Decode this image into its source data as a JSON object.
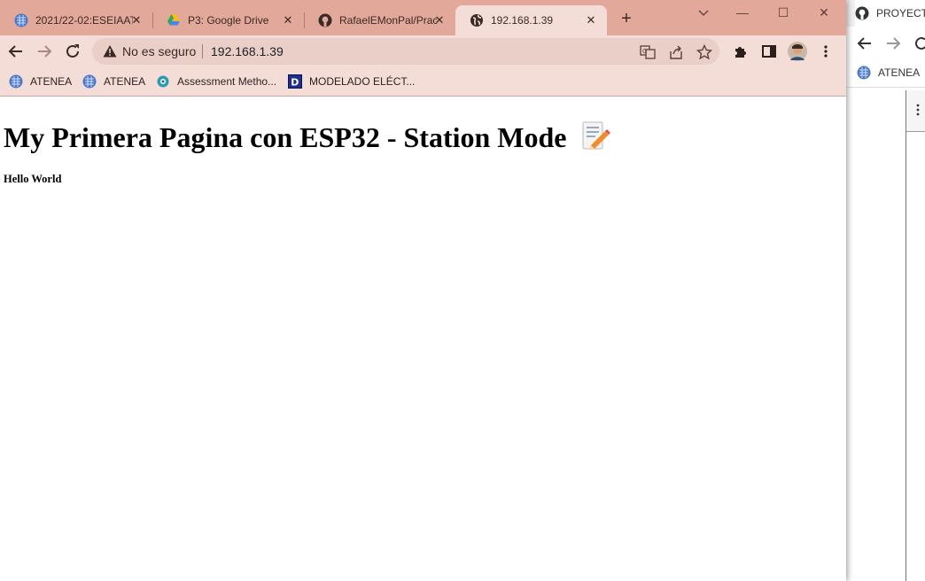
{
  "window": {
    "tabs": [
      {
        "title": "2021/22-02:ESEIAAT",
        "icon": "atenea-globe-icon"
      },
      {
        "title": "P3: Google Drive",
        "icon": "google-drive-icon"
      },
      {
        "title": "RafaelEMonPal/Prac",
        "icon": "github-icon"
      },
      {
        "title": "192.168.1.39",
        "icon": "globe-icon",
        "active": true
      }
    ],
    "controls": {
      "minimize": "—",
      "maximize": "☐",
      "close": "✕"
    }
  },
  "address_bar": {
    "security_label": "No es seguro",
    "url": "192.168.1.39"
  },
  "bookmarks": [
    {
      "label": "ATENEA",
      "icon": "atenea-globe-icon"
    },
    {
      "label": "ATENEA",
      "icon": "atenea-globe-icon"
    },
    {
      "label": "Assessment Metho...",
      "icon": "gear-flower-icon"
    },
    {
      "label": "MODELADO ELÉCT...",
      "icon": "letter-d-icon"
    }
  ],
  "page": {
    "title": "My Primera Pagina con ESP32 - Station Mode",
    "subtitle": "Hello World",
    "title_icon": "memo-pencil-icon"
  },
  "second_window": {
    "tab_title": "PROYECT",
    "bookmark": "ATENEA"
  },
  "colors": {
    "tabstrip": "#e2a99a",
    "toolbar": "#f5ddd7",
    "omnibox": "#e9cfc8"
  }
}
